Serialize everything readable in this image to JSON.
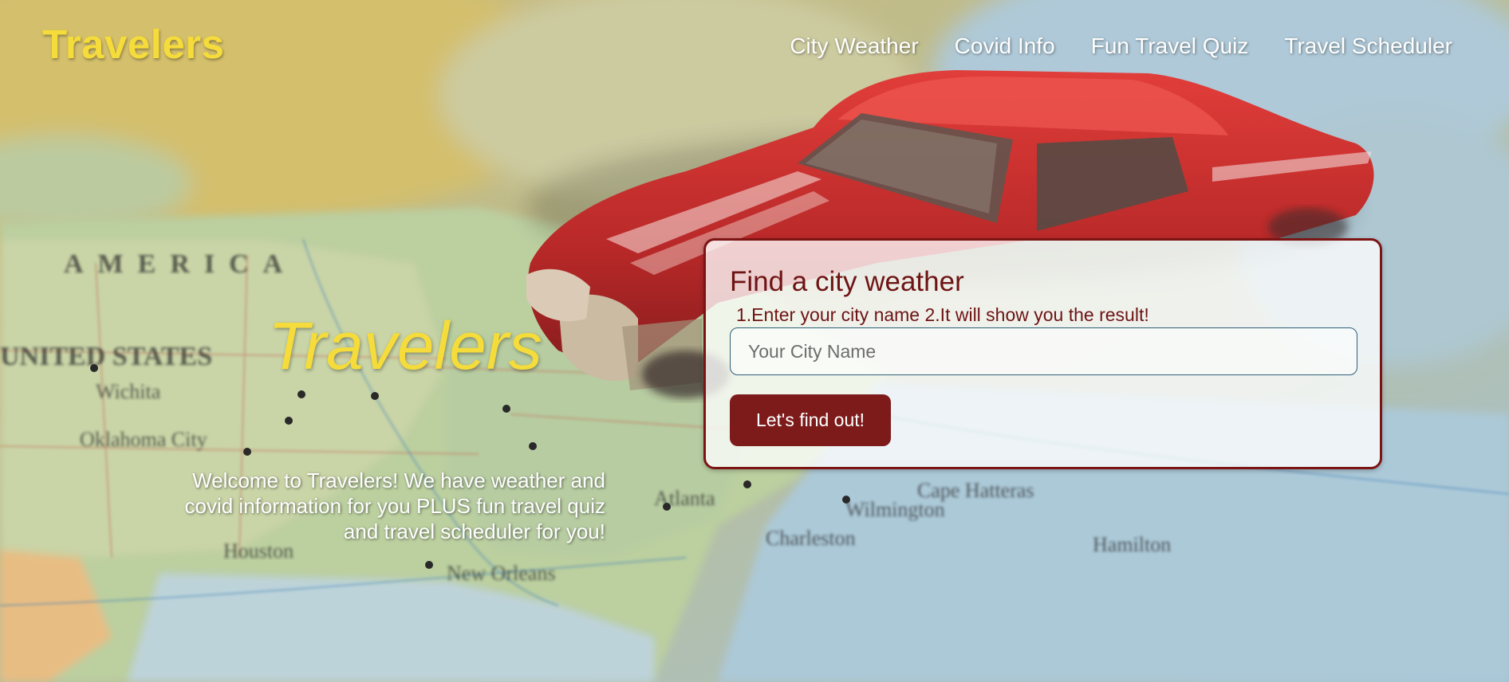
{
  "header": {
    "brand": "Travelers",
    "nav": [
      {
        "label": "City Weather"
      },
      {
        "label": "Covid Info"
      },
      {
        "label": "Fun Travel Quiz"
      },
      {
        "label": "Travel Scheduler"
      }
    ]
  },
  "hero": {
    "title": "Travelers",
    "description": "Welcome to Travelers! We have weather and covid information for you PLUS fun travel quiz and travel scheduler for you!"
  },
  "weather_card": {
    "title": "Find a city weather",
    "instructions": "1.Enter your city name 2.It will show you the result!",
    "input": {
      "placeholder": "Your City Name",
      "value": ""
    },
    "button_label": "Let's find out!"
  },
  "colors": {
    "brand_yellow": "#f5dc3a",
    "accent_maroon": "#7d1a1a",
    "nav_text": "#ffffff"
  }
}
